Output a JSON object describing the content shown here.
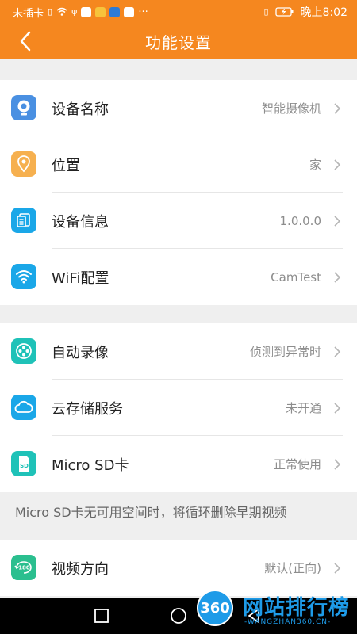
{
  "status_bar": {
    "carrier": "未插卡",
    "time": "晚上8:02",
    "more": "···"
  },
  "header": {
    "title": "功能设置",
    "back_icon": "chevron-left-icon"
  },
  "colors": {
    "brand": "#f5871f",
    "icon_blue": "#4a90e2",
    "icon_orange": "#f6b04f",
    "icon_cyan": "#1aa7e8",
    "icon_teal": "#1fc2b8",
    "icon_green": "#2bbf8f"
  },
  "group1": {
    "items": [
      {
        "label": "设备名称",
        "value": "智能摄像机",
        "icon": "camera-icon"
      },
      {
        "label": "位置",
        "value": "家",
        "icon": "location-pin-icon"
      },
      {
        "label": "设备信息",
        "value": "1.0.0.0",
        "icon": "device-info-icon"
      },
      {
        "label": "WiFi配置",
        "value": "CamTest",
        "icon": "wifi-icon"
      }
    ]
  },
  "group2": {
    "items": [
      {
        "label": "自动录像",
        "value": "侦测到异常时",
        "icon": "auto-record-icon"
      },
      {
        "label": "云存储服务",
        "value": "未开通",
        "icon": "cloud-icon"
      },
      {
        "label": "Micro SD卡",
        "value": "正常使用",
        "icon": "sd-card-icon"
      }
    ]
  },
  "sd_note": "Micro SD卡无可用空间时，将循环删除早期视频",
  "group3": {
    "items": [
      {
        "label": "视频方向",
        "value": "默认(正向)",
        "icon": "rotate-180-icon"
      }
    ]
  },
  "watermark": {
    "logo": "360",
    "title": "网站排行榜",
    "subtitle": "-WANGZHAN360.CN-"
  }
}
